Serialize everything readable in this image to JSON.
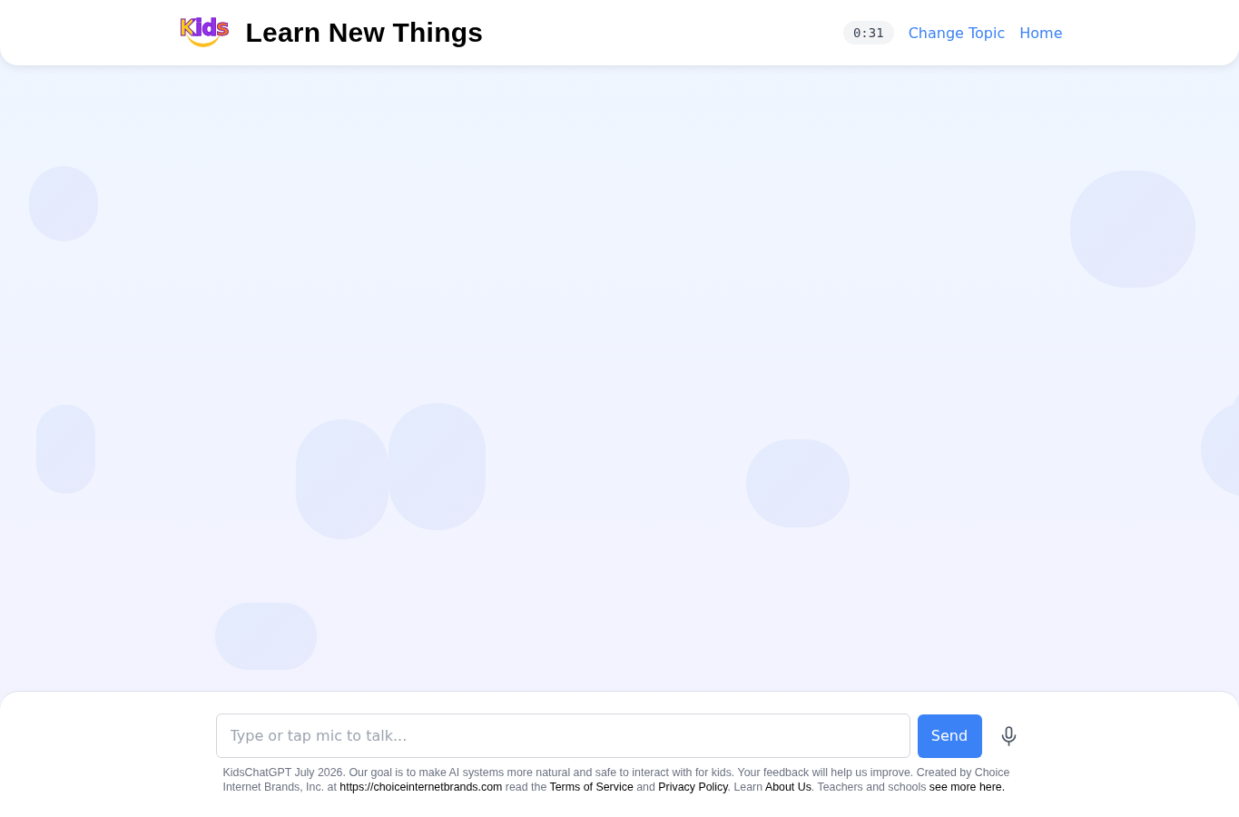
{
  "header": {
    "logo": "Kids",
    "title": "Learn New Things",
    "timer": "0:31",
    "links": [
      "Change Topic",
      "Home"
    ]
  },
  "composer": {
    "placeholder": "Type or tap mic to talk...",
    "send_label": "Send"
  },
  "disclaimer": [
    {
      "kind": "text",
      "text": "KidsChatGPT July 2026. Our goal is to make AI systems more natural and safe to interact with for kids. Your feedback will help us improve. Created by Choice Internet Brands, Inc. at "
    },
    {
      "kind": "link",
      "text": "https://choiceinternetbrands.com"
    },
    {
      "kind": "text",
      "text": " read the "
    },
    {
      "kind": "link",
      "text": "Terms of Service"
    },
    {
      "kind": "text",
      "text": " and "
    },
    {
      "kind": "link",
      "text": "Privacy Policy"
    },
    {
      "kind": "text",
      "text": ". Learn "
    },
    {
      "kind": "link",
      "text": "About Us"
    },
    {
      "kind": "text",
      "text": ". Teachers and schools "
    },
    {
      "kind": "link",
      "text": "see more here."
    }
  ]
}
